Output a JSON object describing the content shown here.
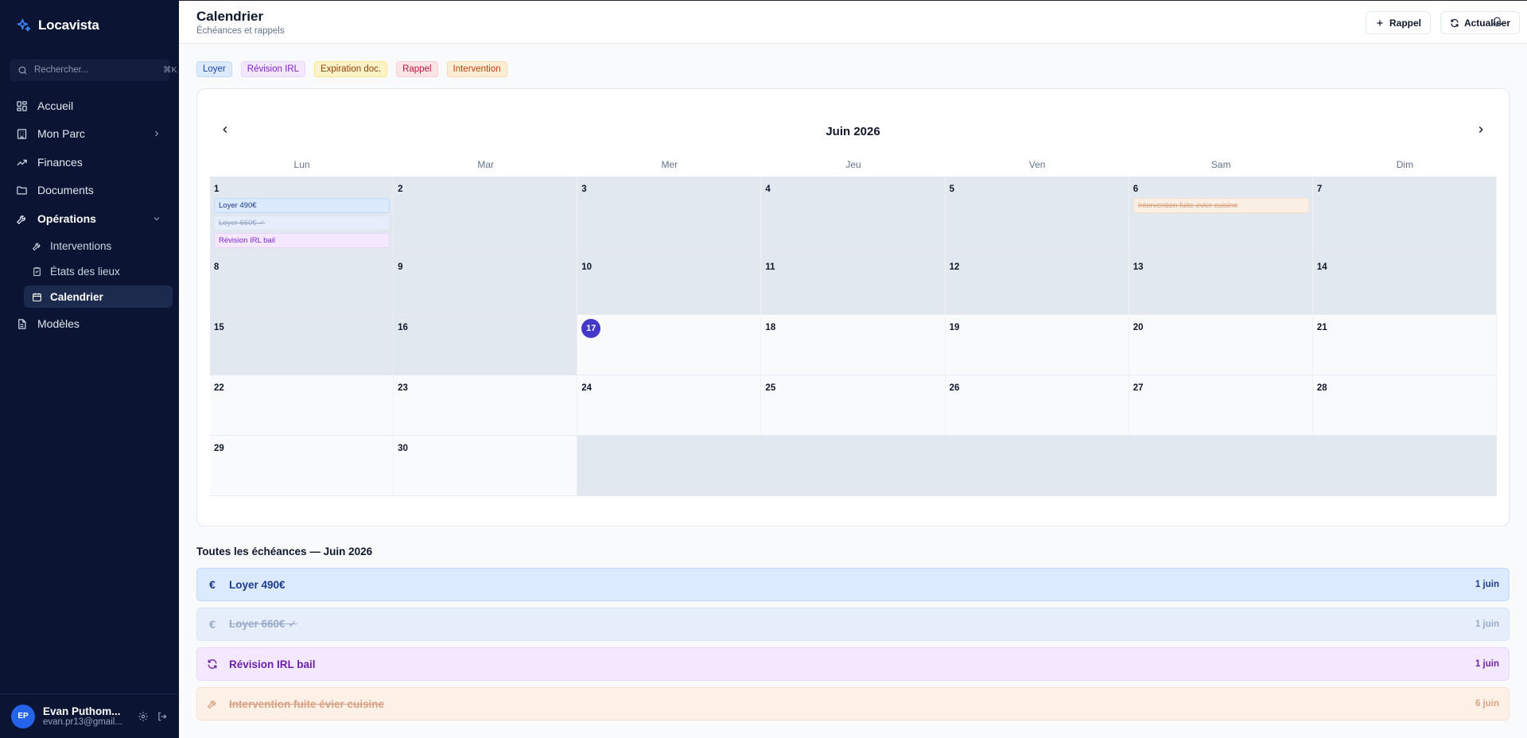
{
  "app": {
    "name": "Locavista"
  },
  "search": {
    "placeholder": "Rechercher...",
    "shortcut": "⌘K"
  },
  "sidebar": {
    "items": [
      {
        "label": "Accueil",
        "icon": "dashboard-icon"
      },
      {
        "label": "Mon Parc",
        "icon": "building-icon"
      },
      {
        "label": "Finances",
        "icon": "trending-up-icon"
      },
      {
        "label": "Documents",
        "icon": "folder-icon"
      },
      {
        "label": "Opérations",
        "icon": "wrench-icon"
      },
      {
        "label": "Modèles",
        "icon": "file-icon"
      }
    ],
    "sub_items": [
      {
        "label": "Interventions",
        "icon": "wrench-icon"
      },
      {
        "label": "États des lieux",
        "icon": "clipboard-icon"
      },
      {
        "label": "Calendrier",
        "icon": "calendar-icon",
        "active": true
      }
    ]
  },
  "user": {
    "initials": "EP",
    "name": "Evan Puthom...",
    "email": "evan.pr13@gmail..."
  },
  "header": {
    "title": "Calendrier",
    "subtitle": "Échéances et rappels",
    "rappel_label": "Rappel",
    "refresh_label": "Actualiser"
  },
  "legend": [
    {
      "label": "Loyer",
      "bg": "#dbeafe",
      "border": "#bfdbfe",
      "color": "#1e40af"
    },
    {
      "label": "Révision IRL",
      "bg": "#f3e8ff",
      "border": "#e9d5ff",
      "color": "#7e22ce"
    },
    {
      "label": "Expiration doc.",
      "bg": "#fef3c7",
      "border": "#fde68a",
      "color": "#92400e"
    },
    {
      "label": "Rappel",
      "bg": "#ffe4e6",
      "border": "#fecdd3",
      "color": "#be123c"
    },
    {
      "label": "Intervention",
      "bg": "#ffedd5",
      "border": "#fed7aa",
      "color": "#c2410c"
    }
  ],
  "calendar": {
    "month_label": "Juin 2026",
    "weekdays": [
      "Lun",
      "Mar",
      "Mer",
      "Jeu",
      "Ven",
      "Sam",
      "Dim"
    ],
    "leading_empty": 0,
    "days_in_month": 30,
    "today": 17,
    "events": {
      "1": [
        {
          "label": "Loyer 490€",
          "type": "loyer"
        },
        {
          "label": "Loyer 660€ ✓",
          "type": "loyer-done"
        },
        {
          "label": "Révision IRL bail",
          "type": "irl"
        }
      ],
      "6": [
        {
          "label": "Intervention fuite évier cuisine",
          "type": "interv"
        }
      ]
    }
  },
  "list": {
    "title": "Toutes les échéances — Juin 2026",
    "items": [
      {
        "name": "Loyer 490€",
        "date": "1 juin",
        "type": "loyer",
        "icon": "€"
      },
      {
        "name": "Loyer 660€ ✓",
        "date": "1 juin",
        "type": "loyer-done",
        "icon": "€"
      },
      {
        "name": "Révision IRL bail",
        "date": "1 juin",
        "type": "irl",
        "icon": "refresh"
      },
      {
        "name": "Intervention fuite évier cuisine",
        "date": "6 juin",
        "type": "interv",
        "icon": "wrench"
      }
    ]
  }
}
